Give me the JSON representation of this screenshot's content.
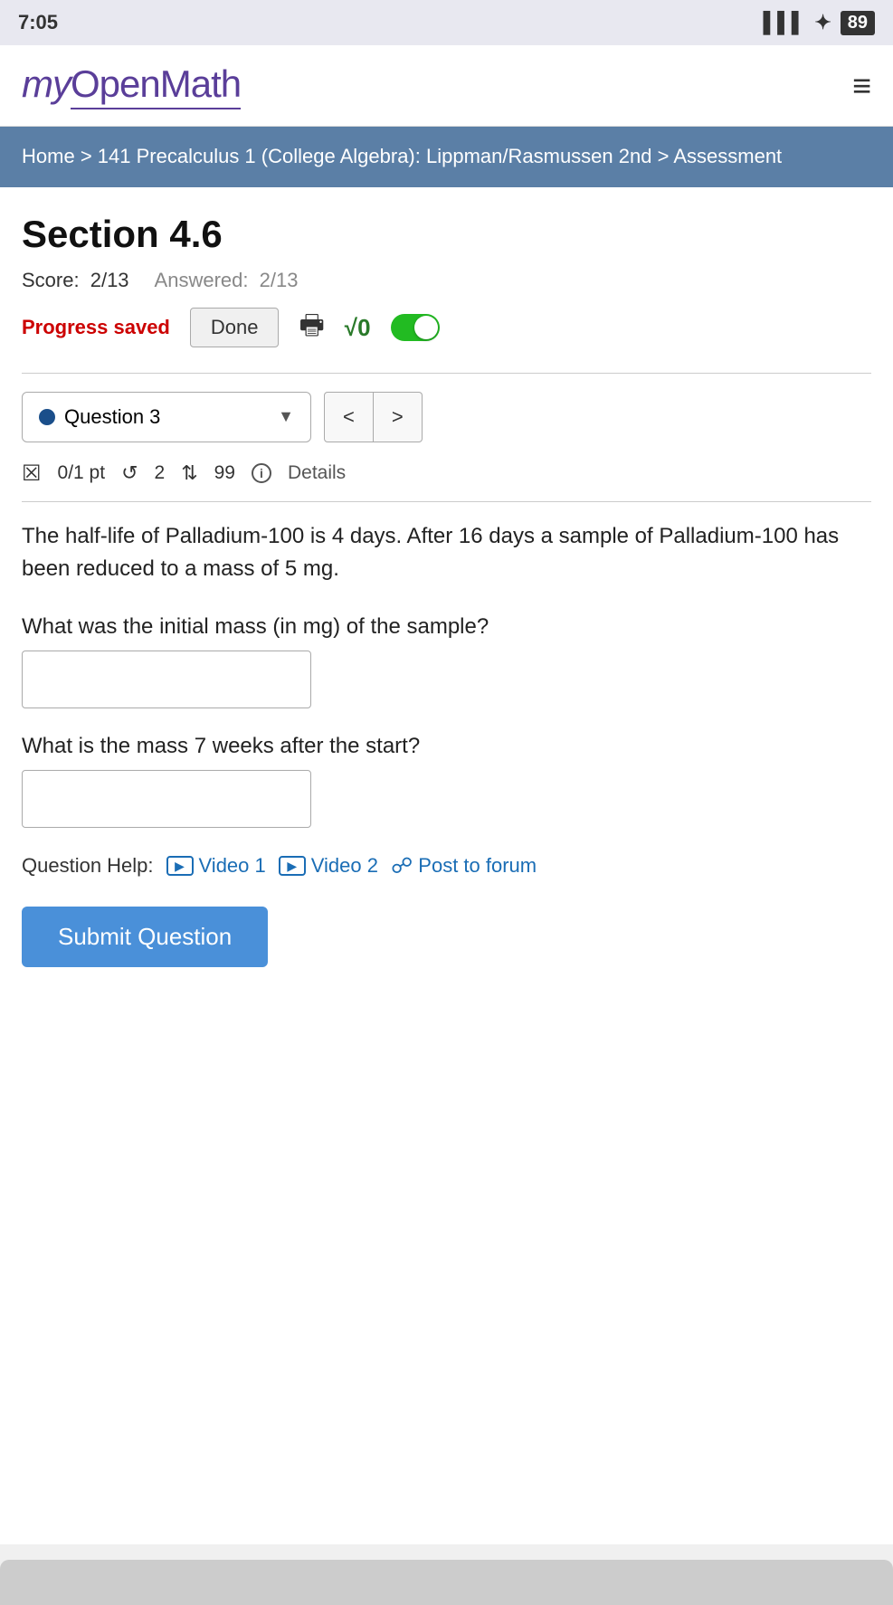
{
  "statusBar": {
    "time": "7:05",
    "battery": "89"
  },
  "header": {
    "logoText": "myOpenMath",
    "menuIcon": "≡"
  },
  "breadcrumb": {
    "parts": [
      "Home",
      "141 Precalculus 1 (College Algebra): Lippman/Rasmussen 2nd",
      "Assessment"
    ]
  },
  "section": {
    "title": "Section 4.6",
    "score": "2/13",
    "answered": "2/13",
    "scoreLabel": "Score:",
    "answeredLabel": "Answered:",
    "progressSaved": "Progress saved",
    "doneLabel": "Done",
    "mathToggleLabel": "√0"
  },
  "questionSelector": {
    "currentQuestion": "Question 3",
    "prevLabel": "<",
    "nextLabel": ">"
  },
  "scoreInfo": {
    "points": "0/1 pt",
    "undoCount": "2",
    "refreshCount": "99",
    "detailsLabel": "Details"
  },
  "problem": {
    "text": "The half-life of Palladium-100 is 4 days. After 16 days a sample of Palladium-100 has been reduced to a mass of 5 mg.",
    "question1": "What was the initial mass (in mg) of the sample?",
    "question2": "What is the mass 7 weeks after the start?",
    "input1Placeholder": "",
    "input2Placeholder": ""
  },
  "questionHelp": {
    "label": "Question Help:",
    "video1Label": "Video 1",
    "video2Label": "Video 2",
    "postToForumLabel": "Post to forum"
  },
  "submitButton": {
    "label": "Submit Question"
  },
  "colors": {
    "accent": "#5a3e99",
    "breadcrumbBg": "#5b7fa6",
    "progressSaved": "#cc0000",
    "toggleOn": "#22bb22",
    "navBlue": "#1a4e8a",
    "submitBlue": "#4a90d9",
    "linkBlue": "#1a6db5"
  }
}
